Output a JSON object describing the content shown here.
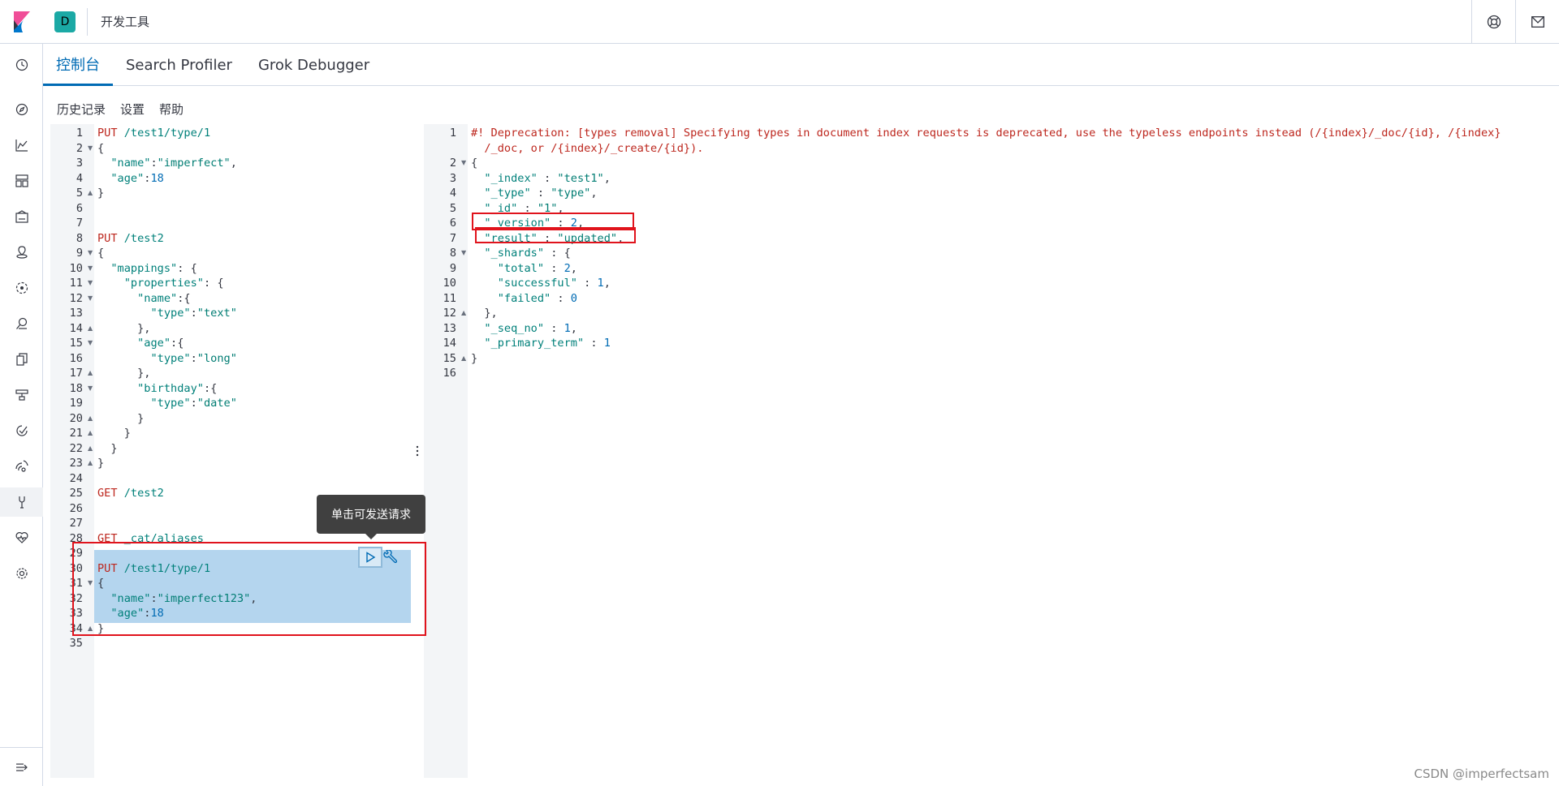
{
  "header": {
    "space_initial": "D",
    "title": "开发工具"
  },
  "nav_icons": [
    "clock-icon",
    "compass-icon",
    "chart-icon",
    "dashboard-icon",
    "canvas-icon",
    "maps-icon",
    "ml-icon",
    "apm-icon",
    "logs-icon",
    "infra-icon",
    "uptime-icon",
    "siem-icon",
    "devtools-icon",
    "monitoring-icon",
    "management-icon"
  ],
  "tabs": [
    {
      "label": "控制台",
      "active": true
    },
    {
      "label": "Search Profiler",
      "active": false
    },
    {
      "label": "Grok Debugger",
      "active": false
    }
  ],
  "menu": {
    "history": "历史记录",
    "settings": "设置",
    "help": "帮助"
  },
  "request_lines": [
    {
      "n": "1",
      "text": "PUT /test1/type/1",
      "kind": "req"
    },
    {
      "n": "2",
      "text": "{",
      "kind": "plain",
      "fold": "▼"
    },
    {
      "n": "3",
      "text": "  \"name\":\"imperfect\",",
      "kind": "plain"
    },
    {
      "n": "4",
      "text": "  \"age\":18",
      "kind": "plain"
    },
    {
      "n": "5",
      "text": "}",
      "kind": "plain",
      "fold": "▲"
    },
    {
      "n": "6",
      "text": "",
      "kind": "plain"
    },
    {
      "n": "7",
      "text": "",
      "kind": "plain"
    },
    {
      "n": "8",
      "text": "PUT /test2",
      "kind": "req"
    },
    {
      "n": "9",
      "text": "{",
      "kind": "plain",
      "fold": "▼"
    },
    {
      "n": "10",
      "text": "  \"mappings\": {",
      "kind": "plain",
      "fold": "▼"
    },
    {
      "n": "11",
      "text": "    \"properties\": {",
      "kind": "plain",
      "fold": "▼"
    },
    {
      "n": "12",
      "text": "      \"name\":{",
      "kind": "plain",
      "fold": "▼"
    },
    {
      "n": "13",
      "text": "        \"type\":\"text\"",
      "kind": "plain"
    },
    {
      "n": "14",
      "text": "      },",
      "kind": "plain",
      "fold": "▲"
    },
    {
      "n": "15",
      "text": "      \"age\":{",
      "kind": "plain",
      "fold": "▼"
    },
    {
      "n": "16",
      "text": "        \"type\":\"long\"",
      "kind": "plain"
    },
    {
      "n": "17",
      "text": "      },",
      "kind": "plain",
      "fold": "▲"
    },
    {
      "n": "18",
      "text": "      \"birthday\":{",
      "kind": "plain",
      "fold": "▼"
    },
    {
      "n": "19",
      "text": "        \"type\":\"date\"",
      "kind": "plain"
    },
    {
      "n": "20",
      "text": "      }",
      "kind": "plain",
      "fold": "▲"
    },
    {
      "n": "21",
      "text": "    }",
      "kind": "plain",
      "fold": "▲"
    },
    {
      "n": "22",
      "text": "  }",
      "kind": "plain",
      "fold": "▲"
    },
    {
      "n": "23",
      "text": "}",
      "kind": "plain",
      "fold": "▲"
    },
    {
      "n": "24",
      "text": "",
      "kind": "plain"
    },
    {
      "n": "25",
      "text": "GET /test2",
      "kind": "req"
    },
    {
      "n": "26",
      "text": "",
      "kind": "plain"
    },
    {
      "n": "27",
      "text": "",
      "kind": "plain"
    },
    {
      "n": "28",
      "text": "GET _cat/aliases",
      "kind": "req"
    },
    {
      "n": "29",
      "text": "",
      "kind": "plain"
    },
    {
      "n": "30",
      "text": "PUT /test1/type/1",
      "kind": "req"
    },
    {
      "n": "31",
      "text": "{",
      "kind": "plain",
      "fold": "▼"
    },
    {
      "n": "32",
      "text": "  \"name\":\"imperfect123\",",
      "kind": "plain"
    },
    {
      "n": "33",
      "text": "  \"age\":18",
      "kind": "plain"
    },
    {
      "n": "34",
      "text": "}",
      "kind": "plain",
      "fold": "▲"
    },
    {
      "n": "35",
      "text": "",
      "kind": "plain"
    }
  ],
  "response_lines": [
    {
      "n": "1",
      "text": "#! Deprecation: [types removal] Specifying types in document index requests is deprecated, use the typeless endpoints instead (/{index}/_doc/{id}, /{index}",
      "kind": "comment"
    },
    {
      "n": "",
      "text": "  /_doc, or /{index}/_create/{id}).",
      "kind": "comment"
    },
    {
      "n": "2",
      "text": "{",
      "kind": "plain",
      "fold": "▼"
    },
    {
      "n": "3",
      "text": "  \"_index\" : \"test1\",",
      "kind": "plain"
    },
    {
      "n": "4",
      "text": "  \"_type\" : \"type\",",
      "kind": "plain"
    },
    {
      "n": "5",
      "text": "  \"_id\" : \"1\",",
      "kind": "plain"
    },
    {
      "n": "6",
      "text": "  \"_version\" : 2,",
      "kind": "plain"
    },
    {
      "n": "7",
      "text": "  \"result\" : \"updated\",",
      "kind": "plain"
    },
    {
      "n": "8",
      "text": "  \"_shards\" : {",
      "kind": "plain",
      "fold": "▼"
    },
    {
      "n": "9",
      "text": "    \"total\" : 2,",
      "kind": "plain"
    },
    {
      "n": "10",
      "text": "    \"successful\" : 1,",
      "kind": "plain"
    },
    {
      "n": "11",
      "text": "    \"failed\" : 0",
      "kind": "plain"
    },
    {
      "n": "12",
      "text": "  },",
      "kind": "plain",
      "fold": "▲"
    },
    {
      "n": "13",
      "text": "  \"_seq_no\" : 1,",
      "kind": "plain"
    },
    {
      "n": "14",
      "text": "  \"_primary_term\" : 1",
      "kind": "plain"
    },
    {
      "n": "15",
      "text": "}",
      "kind": "plain",
      "fold": "▲"
    },
    {
      "n": "16",
      "text": "",
      "kind": "plain"
    }
  ],
  "tooltip": "单击可发送请求",
  "watermark": "CSDN @imperfectsam"
}
